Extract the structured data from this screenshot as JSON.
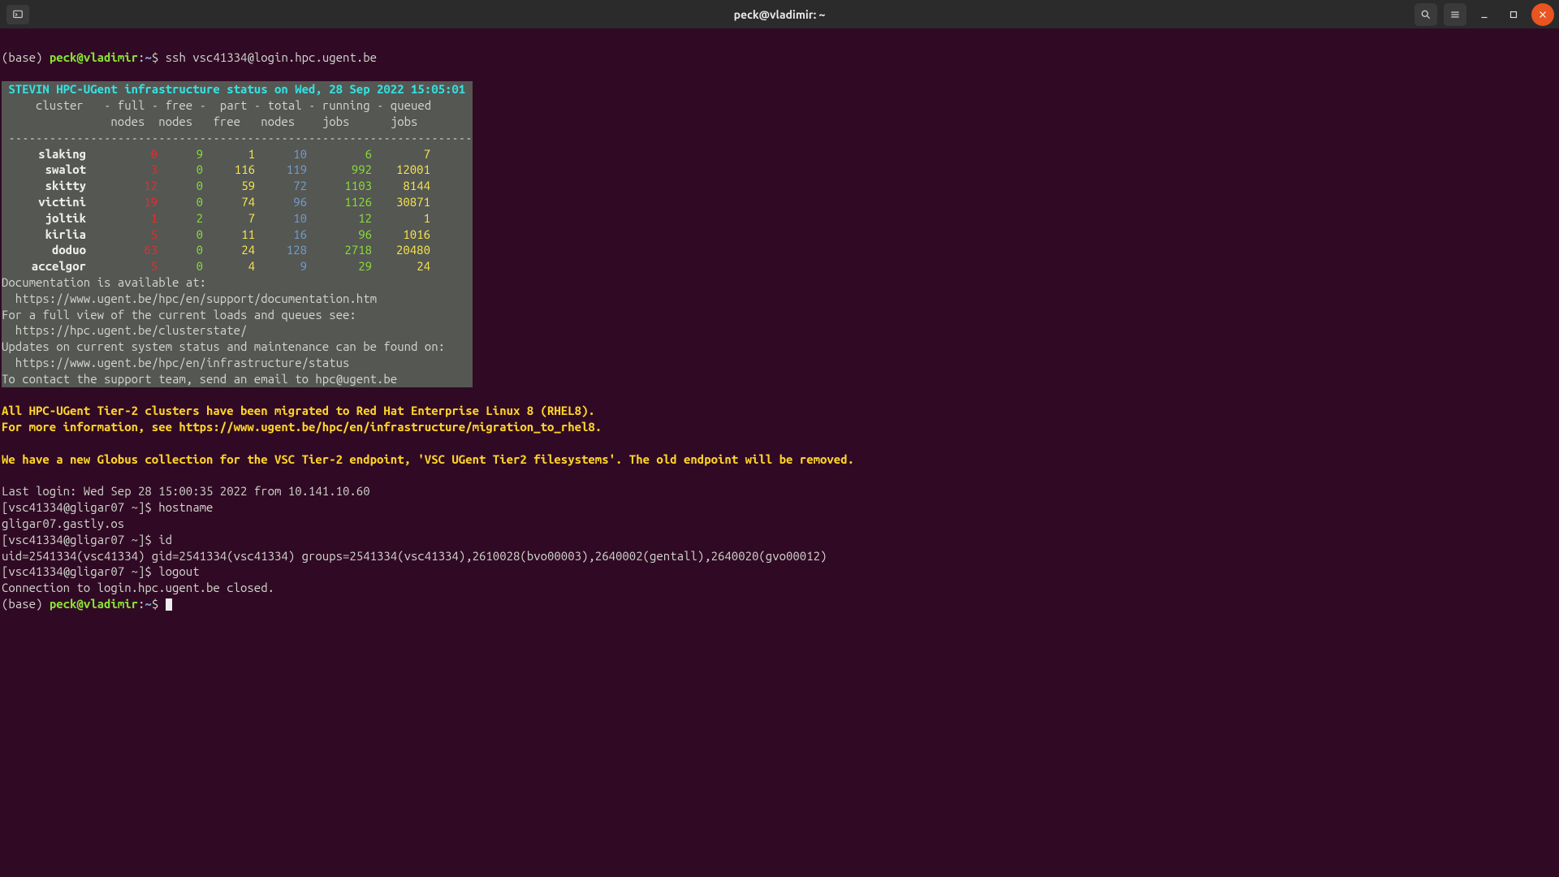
{
  "window": {
    "title": "peck@vladimir: ~"
  },
  "prompt1": {
    "base": "(base) ",
    "user": "peck@vladimir",
    "colon": ":",
    "path": "~",
    "dollar": "$ ",
    "cmd": "ssh vsc41334@login.hpc.ugent.be"
  },
  "banner": {
    "header": " STEVIN HPC-UGent infrastructure status on Wed, 28 Sep 2022 15:05:01",
    "hdr1": "     cluster   - full - free -  part - total - running - queued",
    "hdr2": "                nodes  nodes   free   nodes    jobs      jobs  ",
    "sep": " --------------------------------------------------------------------"
  },
  "clusters": [
    {
      "name": "slaking",
      "full": "0",
      "free": "9",
      "part": "1",
      "total": "10",
      "running": "6",
      "queued": "7"
    },
    {
      "name": "swalot",
      "full": "3",
      "free": "0",
      "part": "116",
      "total": "119",
      "running": "992",
      "queued": "12001"
    },
    {
      "name": "skitty",
      "full": "12",
      "free": "0",
      "part": "59",
      "total": "72",
      "running": "1103",
      "queued": "8144"
    },
    {
      "name": "victini",
      "full": "19",
      "free": "0",
      "part": "74",
      "total": "96",
      "running": "1126",
      "queued": "30871"
    },
    {
      "name": "joltik",
      "full": "1",
      "free": "2",
      "part": "7",
      "total": "10",
      "running": "12",
      "queued": "1"
    },
    {
      "name": "kirlia",
      "full": "5",
      "free": "0",
      "part": "11",
      "total": "16",
      "running": "96",
      "queued": "1016"
    },
    {
      "name": "doduo",
      "full": "63",
      "free": "0",
      "part": "24",
      "total": "128",
      "running": "2718",
      "queued": "20480"
    },
    {
      "name": "accelgor",
      "full": "5",
      "free": "0",
      "part": "4",
      "total": "9",
      "running": "29",
      "queued": "24"
    }
  ],
  "info": {
    "l1": "Documentation is available at:",
    "l2": "  https://www.ugent.be/hpc/en/support/documentation.htm",
    "l3": "For a full view of the current loads and queues see:",
    "l4": "  https://hpc.ugent.be/clusterstate/",
    "l5": "Updates on current system status and maintenance can be found on:",
    "l6": "  https://www.ugent.be/hpc/en/infrastructure/status",
    "l7": "To contact the support team, send an email to hpc@ugent.be"
  },
  "notices": {
    "n1": "All HPC-UGent Tier-2 clusters have been migrated to Red Hat Enterprise Linux 8 (RHEL8).",
    "n2": "For more information, see https://www.ugent.be/hpc/en/infrastructure/migration_to_rhel8.",
    "n3": "We have a new Globus collection for the VSC Tier-2 endpoint, 'VSC UGent Tier2 filesystems'. The old endpoint will be removed."
  },
  "session": {
    "last": "Last login: Wed Sep 28 15:00:35 2022 from 10.141.10.60",
    "p1": "[vsc41334@gligar07 ~]$ ",
    "c1": "hostname",
    "o1": "gligar07.gastly.os",
    "p2": "[vsc41334@gligar07 ~]$ ",
    "c2": "id",
    "o2": "uid=2541334(vsc41334) gid=2541334(vsc41334) groups=2541334(vsc41334),2610028(bvo00003),2640002(gentall),2640020(gvo00012)",
    "p3": "[vsc41334@gligar07 ~]$ ",
    "c3": "logout",
    "o3": "Connection to login.hpc.ugent.be closed."
  },
  "prompt2": {
    "base": "(base) ",
    "user": "peck@vladimir",
    "colon": ":",
    "path": "~",
    "dollar": "$ "
  }
}
